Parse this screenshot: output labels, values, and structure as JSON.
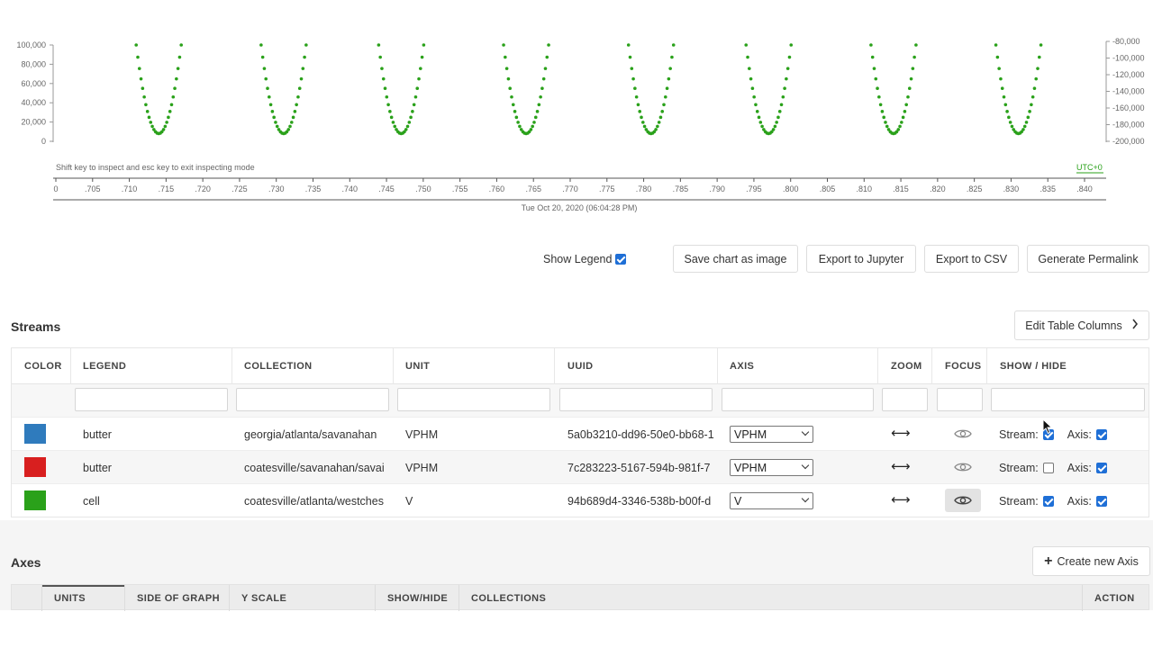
{
  "chart": {
    "left_axis_ticks": [
      "100,000",
      "80,000",
      "60,000",
      "40,000",
      "20,000",
      "0"
    ],
    "right_axis_ticks": [
      "-80,000",
      "-100,000",
      "-120,000",
      "-140,000",
      "-160,000",
      "-180,000",
      "-200,000"
    ],
    "hint": "Shift key to inspect and esc key to exit inspecting mode",
    "utc": "UTC+0",
    "time_ticks": [
      "0",
      ".705",
      ".710",
      ".715",
      ".720",
      ".725",
      ".730",
      ".735",
      ".740",
      ".745",
      ".750",
      ".755",
      ".760",
      ".765",
      ".770",
      ".775",
      ".780",
      ".785",
      ".790",
      ".795",
      ".800",
      ".805",
      ".810",
      ".815",
      ".820",
      ".825",
      ".830",
      ".835",
      ".840"
    ],
    "date_label": "Tue Oct 20, 2020 (06:04:28 PM)",
    "series_color": "#2aa11a"
  },
  "chart_data": {
    "type": "scatter",
    "yticks_left": [
      0,
      20000,
      40000,
      60000,
      80000,
      100000
    ],
    "yticks_right": [
      -80000,
      -100000,
      -120000,
      -140000,
      -160000,
      -180000,
      -200000
    ],
    "ylim": [
      0,
      100000
    ],
    "series": [
      {
        "color": "#2aa11a",
        "note_values": "repeating parabolic dips, minimum about 8,000 between the edges at about 100,000",
        "dips_minimum_x": [
          ".714",
          ".731",
          ".747",
          ".764",
          ".781",
          ".797",
          ".814",
          ".831"
        ],
        "minimum_y": 8000,
        "top_y": 100000
      }
    ]
  },
  "toolbar": {
    "show_legend_label": "Show Legend",
    "buttons": [
      "Save chart as image",
      "Export to Jupyter",
      "Export to CSV",
      "Generate Permalink"
    ]
  },
  "streams": {
    "title": "Streams",
    "edit_columns_label": "Edit Table Columns",
    "columns": [
      "COLOR",
      "LEGEND",
      "COLLECTION",
      "UNIT",
      "UUID",
      "AXIS",
      "ZOOM",
      "FOCUS",
      "SHOW / HIDE"
    ],
    "rows": [
      {
        "color": "#2f7bbd",
        "legend": "butter",
        "collection": "georgia/atlanta/savanahan",
        "unit": "VPHM",
        "uuid": "5a0b3210-dd96-50e0-bb68-1",
        "axis": "VPHM",
        "stream_label": "Stream:",
        "axis_label": "Axis:"
      },
      {
        "color": "#d81f1f",
        "legend": "butter",
        "collection": "coatesville/savanahan/savai",
        "unit": "VPHM",
        "uuid": "7c283223-5167-594b-981f-7",
        "axis": "VPHM",
        "stream_label": "Stream:",
        "axis_label": "Axis:"
      },
      {
        "color": "#2aa11a",
        "legend": "cell",
        "collection": "coatesville/atlanta/westches",
        "unit": "V",
        "uuid": "94b689d4-3346-538b-b00f-d",
        "axis": "V",
        "stream_label": "Stream:",
        "axis_label": "Axis:"
      }
    ]
  },
  "axes": {
    "title": "Axes",
    "create_label": "Create new Axis",
    "columns": [
      "UNITS",
      "SIDE OF GRAPH",
      "Y SCALE",
      "SHOW/HIDE",
      "COLLECTIONS",
      "ACTION"
    ]
  }
}
